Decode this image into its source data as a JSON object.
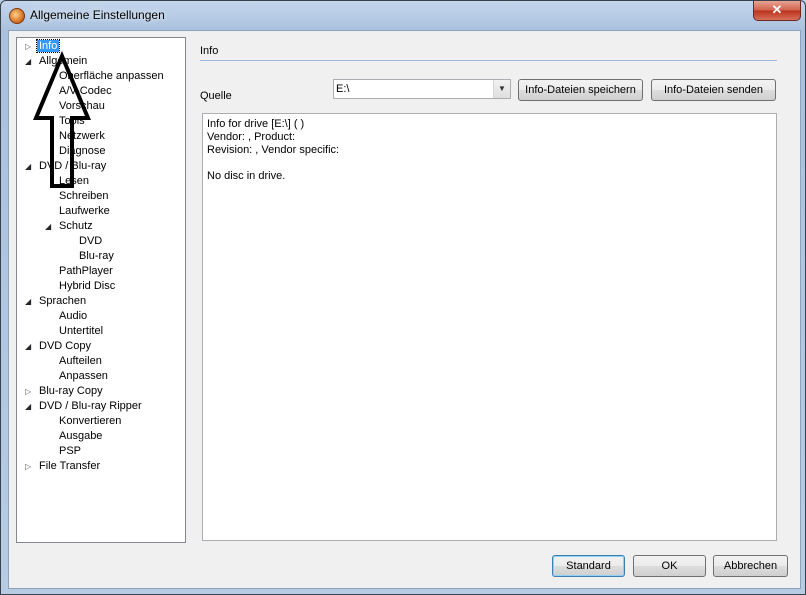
{
  "window": {
    "title": "Allgemeine Einstellungen",
    "close_label": "✕"
  },
  "tree": {
    "items": [
      {
        "label": "Info",
        "level": 0,
        "arrow": "collapsed",
        "selected": true
      },
      {
        "label": "Allgemein",
        "level": 0,
        "arrow": "expanded"
      },
      {
        "label": "Oberfläche anpassen",
        "level": 1
      },
      {
        "label": "A/V-Codec",
        "level": 1
      },
      {
        "label": "Vorschau",
        "level": 1
      },
      {
        "label": "Tools",
        "level": 1
      },
      {
        "label": "Netzwerk",
        "level": 1
      },
      {
        "label": "Diagnose",
        "level": 1
      },
      {
        "label": "DVD / Blu-ray",
        "level": 0,
        "arrow": "expanded"
      },
      {
        "label": "Lesen",
        "level": 1
      },
      {
        "label": "Schreiben",
        "level": 1
      },
      {
        "label": "Laufwerke",
        "level": 1
      },
      {
        "label": "Schutz",
        "level": 1,
        "arrow": "expanded"
      },
      {
        "label": "DVD",
        "level": 2
      },
      {
        "label": "Blu-ray",
        "level": 2
      },
      {
        "label": "PathPlayer",
        "level": 1
      },
      {
        "label": "Hybrid Disc",
        "level": 1
      },
      {
        "label": "Sprachen",
        "level": 0,
        "arrow": "expanded"
      },
      {
        "label": "Audio",
        "level": 1
      },
      {
        "label": "Untertitel",
        "level": 1
      },
      {
        "label": "DVD Copy",
        "level": 0,
        "arrow": "expanded"
      },
      {
        "label": "Aufteilen",
        "level": 1
      },
      {
        "label": "Anpassen",
        "level": 1
      },
      {
        "label": "Blu-ray Copy",
        "level": 0,
        "arrow": "collapsed"
      },
      {
        "label": "DVD / Blu-ray Ripper",
        "level": 0,
        "arrow": "expanded"
      },
      {
        "label": "Konvertieren",
        "level": 1
      },
      {
        "label": "Ausgabe",
        "level": 1
      },
      {
        "label": "PSP",
        "level": 1
      },
      {
        "label": "File Transfer",
        "level": 0,
        "arrow": "collapsed"
      }
    ]
  },
  "page": {
    "group_title": "Info",
    "source_label": "Quelle",
    "source_value": "E:\\",
    "save_button": "Info-Dateien speichern",
    "send_button": "Info-Dateien senden",
    "info_lines": [
      "Info for drive [E:\\] ( )",
      "Vendor: , Product:",
      "Revision: , Vendor specific:",
      "",
      "No disc in drive."
    ]
  },
  "footer": {
    "standard_button": "Standard",
    "ok_button": "OK",
    "cancel_button": "Abbrechen"
  },
  "colors": {
    "selection": "#3399ff",
    "group_line": "#9dbbd9",
    "close_button": "#c7402a",
    "annotation_arrow": "#000000"
  }
}
